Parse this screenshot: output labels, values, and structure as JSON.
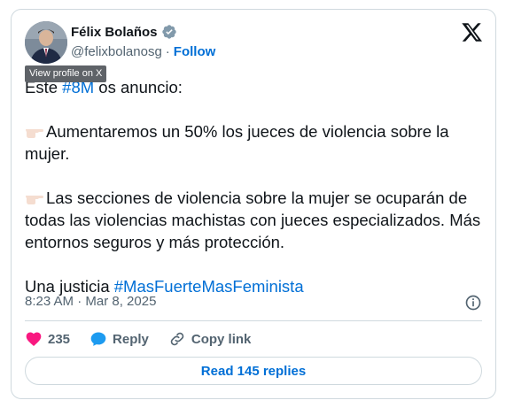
{
  "author": {
    "name": "Félix Bolaños",
    "handle": "@felixbolanosg",
    "separator": "·",
    "follow_label": "Follow",
    "avatar": "avatar-photo",
    "verified": "verified-badge-icon"
  },
  "tooltip": "View profile on X",
  "tweet": {
    "line1_pre": "Este ",
    "line1_hashtag": "#8M",
    "line1_post": " os anuncio:",
    "para2": "Aumentaremos un 50% los jueces de violencia sobre la mujer.",
    "para3": "Las secciones de violencia sobre la mujer se ocuparán de todas las violencias machistas con jueces especializados. Más entornos seguros y más protección.",
    "para4_pre": "Una justicia ",
    "para4_hashtag": "#MasFuerteMasFeminista",
    "pointer_emoji": "👉🏻"
  },
  "meta": {
    "timestamp": "8:23 AM · Mar 8, 2025"
  },
  "actions": {
    "like_count": "235",
    "reply_label": "Reply",
    "copy_label": "Copy link"
  },
  "read_replies_label": "Read 145 replies",
  "colors": {
    "link": "#006fd6",
    "like": "#f91880",
    "border": "#cfd9de"
  }
}
